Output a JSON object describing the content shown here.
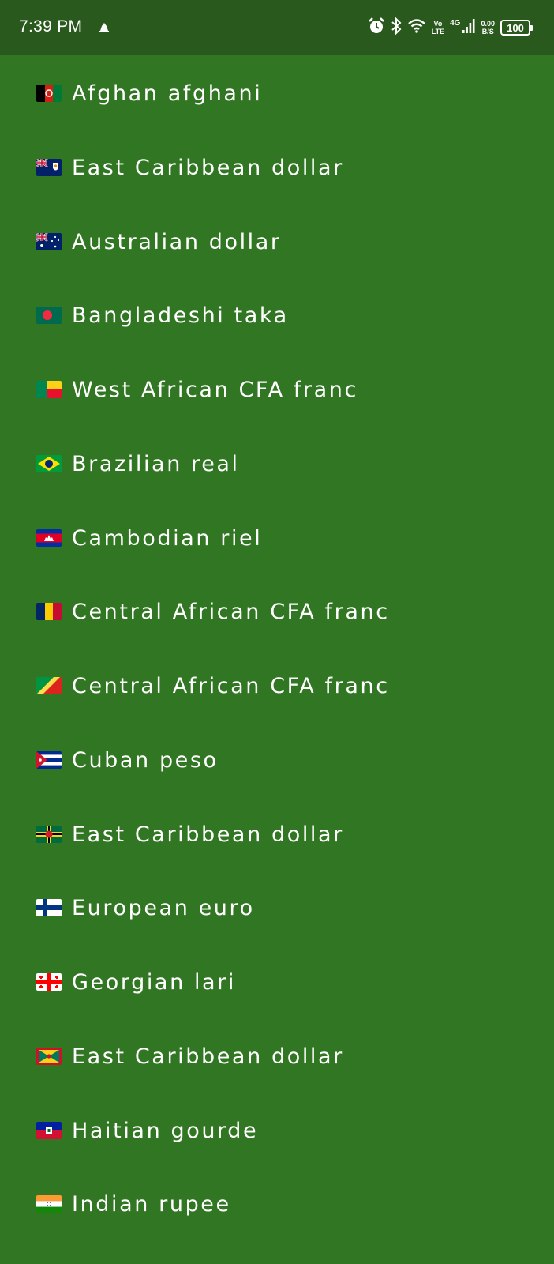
{
  "status_bar": {
    "time": "7:39 PM",
    "volte_top": "Vo",
    "volte_bottom": "LTE",
    "network": "4G",
    "speed_value": "0.00",
    "speed_unit": "B/S",
    "battery": "100",
    "icons": [
      "notification-icon",
      "alarm-icon",
      "bluetooth-icon",
      "wifi-icon",
      "signal-icon",
      "battery-icon"
    ]
  },
  "colors": {
    "background": "#317622",
    "status_bar": "#29591c",
    "text": "#ffffff"
  },
  "currencies": [
    {
      "name": "Afghan afghani",
      "flag": "flag-afghanistan-icon"
    },
    {
      "name": "East Caribbean dollar",
      "flag": "flag-anguilla-icon"
    },
    {
      "name": "Australian dollar",
      "flag": "flag-australia-icon"
    },
    {
      "name": "Bangladeshi taka",
      "flag": "flag-bangladesh-icon"
    },
    {
      "name": "West African CFA franc",
      "flag": "flag-benin-icon"
    },
    {
      "name": "Brazilian real",
      "flag": "flag-brazil-icon"
    },
    {
      "name": "Cambodian riel",
      "flag": "flag-cambodia-icon"
    },
    {
      "name": "Central African CFA franc",
      "flag": "flag-chad-icon"
    },
    {
      "name": "Central African CFA franc",
      "flag": "flag-congo-icon"
    },
    {
      "name": "Cuban peso",
      "flag": "flag-cuba-icon"
    },
    {
      "name": "East Caribbean dollar",
      "flag": "flag-dominica-icon"
    },
    {
      "name": "European euro",
      "flag": "flag-finland-icon"
    },
    {
      "name": "Georgian lari",
      "flag": "flag-georgia-icon"
    },
    {
      "name": "East Caribbean dollar",
      "flag": "flag-grenada-icon"
    },
    {
      "name": "Haitian gourde",
      "flag": "flag-haiti-icon"
    },
    {
      "name": "Indian rupee",
      "flag": "flag-india-icon"
    }
  ]
}
